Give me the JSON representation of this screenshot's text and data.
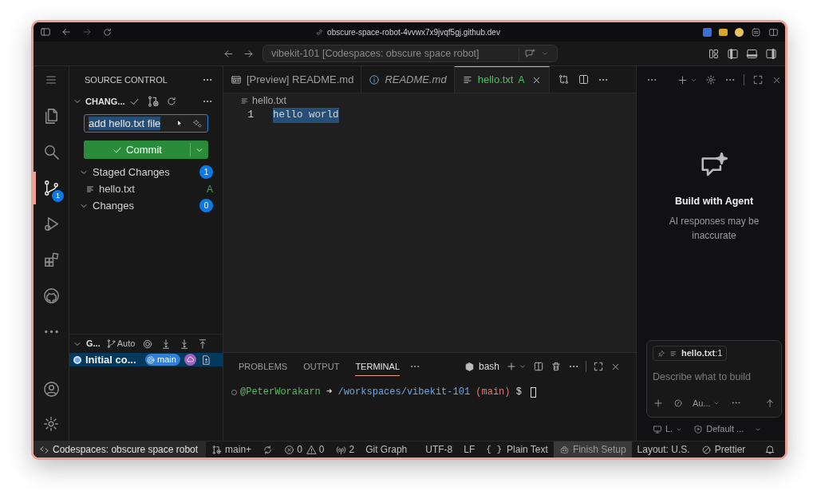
{
  "browser": {
    "url": "obscure-space-robot-4vvwx7x9jvqf5gj.github.dev"
  },
  "title_bar": {
    "command_center": "vibekit-101 [Codespaces: obscure space robot]"
  },
  "activity_bar": {
    "items": [
      {
        "kind": "explorer",
        "selected": false
      },
      {
        "kind": "search",
        "selected": false
      },
      {
        "kind": "scm",
        "selected": true,
        "badge": "1"
      },
      {
        "kind": "run",
        "selected": false
      },
      {
        "kind": "extensions",
        "selected": false
      },
      {
        "kind": "github",
        "selected": false
      },
      {
        "kind": "more",
        "selected": false
      }
    ]
  },
  "source_control": {
    "title": "SOURCE CONTROL",
    "section": "CHANG...",
    "commit_message": "add hello.txt file",
    "commit_button": "Commit",
    "groups": [
      {
        "label": "Staged Changes",
        "count": "1",
        "expanded": true,
        "files": [
          {
            "name": "hello.txt",
            "status": "A"
          }
        ]
      },
      {
        "label": "Changes",
        "count": "0",
        "expanded": true
      }
    ]
  },
  "graph": {
    "title": "G...",
    "mode": "Auto",
    "commits": [
      {
        "message": "Initial co...",
        "branch": "main",
        "selected": true
      }
    ]
  },
  "tabs": [
    {
      "label": "[Preview] README.md",
      "kind": "preview",
      "preview": false,
      "selected": false
    },
    {
      "label": "README.md",
      "kind": "info",
      "preview": true,
      "selected": false
    },
    {
      "label": "hello.txt",
      "kind": "text",
      "preview": false,
      "selected": true,
      "status": "A"
    }
  ],
  "editor": {
    "breadcrumb": "hello.txt",
    "lines": [
      {
        "number": "1",
        "text": "hello world",
        "selected": true
      }
    ]
  },
  "panel": {
    "tabs": [
      {
        "label": "PROBLEMS",
        "selected": false
      },
      {
        "label": "OUTPUT",
        "selected": false
      },
      {
        "label": "TERMINAL",
        "selected": true
      }
    ],
    "shell": "bash",
    "terminal": {
      "user": "@PeterWorakarn",
      "arrow": "➜",
      "path": "/workspaces/vibekit-101",
      "branch": "(main)",
      "prompt": "$"
    }
  },
  "chat": {
    "title": "Build with Agent",
    "subtitle": "AI responses may be inaccurate",
    "context": "**hello.txt**:1",
    "placeholder": "Describe what to build",
    "mode": "Au...",
    "target": "L.",
    "approvals": "Default ..."
  },
  "status_bar": {
    "remote": "Codespaces: obscure space robot",
    "branch": "main+",
    "errors": "0",
    "warnings": "0",
    "ports": "2",
    "git_graph": "Git Graph",
    "encoding": "UTF-8",
    "eol": "LF",
    "language_icon": "{ }",
    "language": "Plain Text",
    "setup": "Finish Setup",
    "layout": "Layout: U.S.",
    "formatter": "Prettier"
  }
}
